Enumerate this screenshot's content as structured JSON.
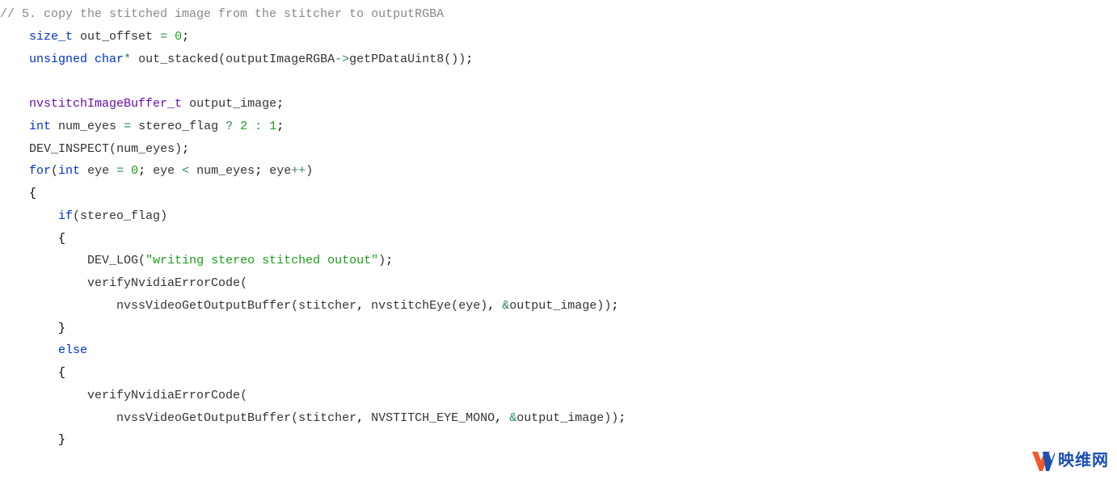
{
  "code": {
    "l1": {
      "comment": "// 5. copy the stitched image from the stitcher to outputRGBA"
    },
    "l2": {
      "kw_sizet": "size_t",
      "id": " out_offset ",
      "eq": "=",
      "sp": " ",
      "num": "0",
      "semi": ";"
    },
    "l3": {
      "kw_unsigned": "unsigned",
      "sp1": " ",
      "kw_char": "char",
      "star": "* ",
      "id": "out_stacked",
      "lp": "(",
      "obj": "outputImageRGBA",
      "arrow": "->",
      "fn": "getPDataUint8",
      "lp2": "()",
      "rp": ")",
      "semi": ";"
    },
    "l5": {
      "type": "nvstitchImageBuffer_t",
      "sp": " ",
      "id": "output_image",
      "semi": ";"
    },
    "l6": {
      "kw_int": "int",
      "sp1": " ",
      "id": "num_eyes ",
      "eq": "=",
      "sp2": " stereo_flag ",
      "q": "?",
      "sp3": " ",
      "n1": "2",
      "sp4": " ",
      "colon": ":",
      "sp5": " ",
      "n2": "1",
      "semi": ";"
    },
    "l7": {
      "fn": "DEV_INSPECT",
      "lp": "(",
      "arg": "num_eyes",
      "rp": ")",
      "semi": ";"
    },
    "l8": {
      "kw_for": "for",
      "lp": "(",
      "kw_int": "int",
      "sp1": " eye ",
      "eq": "=",
      "sp2": " ",
      "n0": "0",
      "semi1": ";",
      "cond": " eye ",
      "lt": "<",
      "cond2": " num_eyes",
      "semi2": ";",
      "inc": " eye",
      "plus": "++",
      "rp": ")"
    },
    "l9": {
      "brace": "{"
    },
    "l10": {
      "kw_if": "if",
      "lp": "(",
      "cond": "stereo_flag",
      "rp": ")"
    },
    "l11": {
      "brace": "{"
    },
    "l12": {
      "fn": "DEV_LOG",
      "lp": "(",
      "str": "\"writing stereo stitched outout\"",
      "rp": ")",
      "semi": ";"
    },
    "l13": {
      "fn": "verifyNvidiaErrorCode",
      "lp": "("
    },
    "l14": {
      "fn": "nvssVideoGetOutputBuffer",
      "lp": "(",
      "a1": "stitcher",
      "c1": ",",
      "sp1": " ",
      "fn2": "nvstitchEye",
      "lp2": "(",
      "a2": "eye",
      "rp2": ")",
      "c2": ",",
      "sp2": " ",
      "amp": "&",
      "a3": "output_image",
      "rp": ")",
      "rp_outer": ")",
      "semi": ";"
    },
    "l15": {
      "brace": "}"
    },
    "l16": {
      "kw_else": "else"
    },
    "l17": {
      "brace": "{"
    },
    "l18": {
      "fn": "verifyNvidiaErrorCode",
      "lp": "("
    },
    "l19": {
      "fn": "nvssVideoGetOutputBuffer",
      "lp": "(",
      "a1": "stitcher",
      "c1": ",",
      "sp1": " ",
      "a2": "NVSTITCH_EYE_MONO",
      "c2": ",",
      "sp2": " ",
      "amp": "&",
      "a3": "output_image",
      "rp": ")",
      "rp_outer": ")",
      "semi": ";"
    },
    "l20": {
      "brace": "}"
    }
  },
  "indent": {
    "i1": "    ",
    "i2": "        ",
    "i3": "            ",
    "i4": "                "
  },
  "watermark": {
    "text": "映维网"
  }
}
